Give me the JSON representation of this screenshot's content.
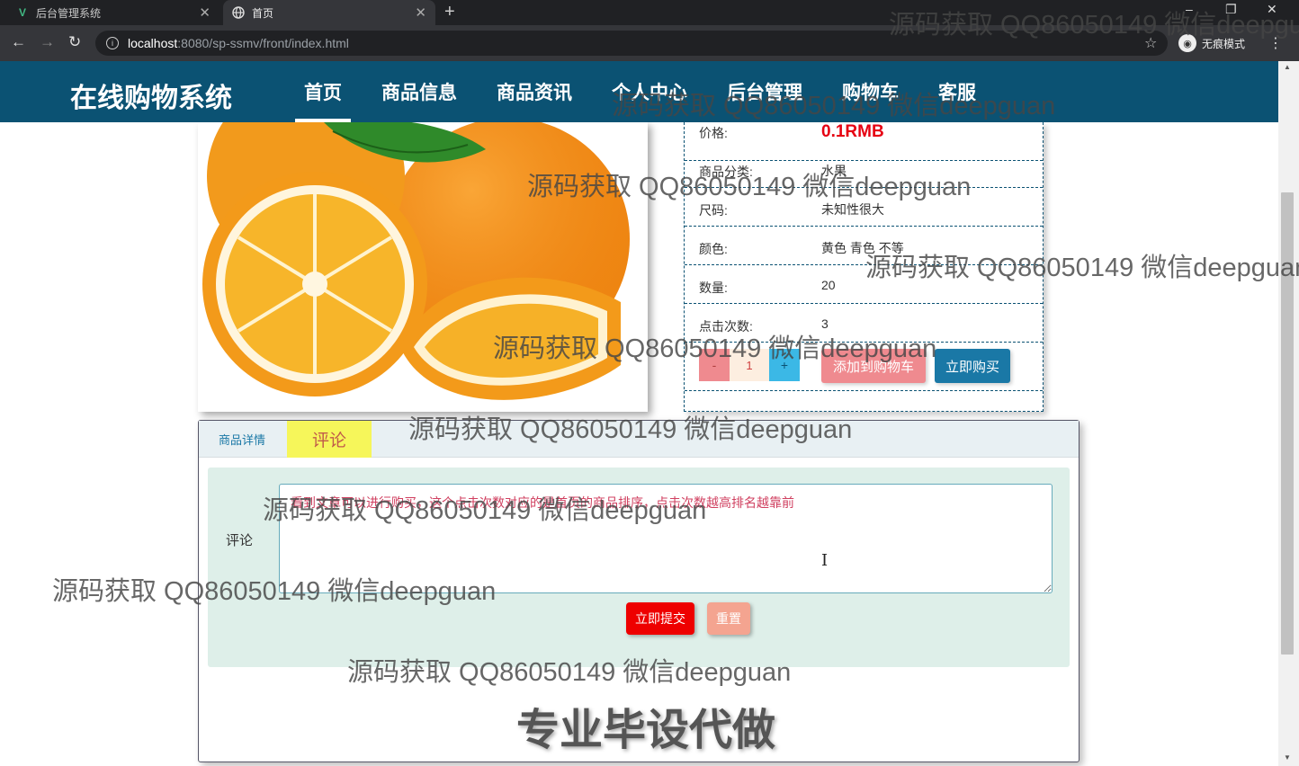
{
  "browser": {
    "tabs": [
      {
        "label": "后台管理系统",
        "icon": "vue-logo-icon",
        "active": false
      },
      {
        "label": "首页",
        "icon": "globe-icon",
        "active": true
      }
    ],
    "url_host": "localhost",
    "url_path": ":8080/sp-ssmv/front/index.html",
    "incognito_label": "无痕模式"
  },
  "site": {
    "brand": "在线购物系统",
    "nav": [
      "首页",
      "商品信息",
      "商品资讯",
      "个人中心",
      "后台管理",
      "购物车",
      "客服"
    ],
    "active_nav": "首页",
    "colors": {
      "nav_bg": "#0b5273",
      "price": "#e60012"
    }
  },
  "product": {
    "image_alt": "orange",
    "specs": [
      {
        "key": "价格:",
        "value": "0.1RMB"
      },
      {
        "key": "商品分类:",
        "value": "水果"
      },
      {
        "key": "尺码:",
        "value": "未知性很大"
      },
      {
        "key": "颜色:",
        "value": "黄色 青色 不等"
      },
      {
        "key": "数量:",
        "value": "20"
      },
      {
        "key": "点击次数:",
        "value": "3"
      }
    ],
    "qty": {
      "minus": "-",
      "value": "1",
      "plus": "+"
    },
    "add_to_cart": "添加到购物车",
    "buy_now": "立即购买"
  },
  "tabs_panel": {
    "tabs": [
      "商品详情",
      "评论"
    ],
    "active_tab": "评论",
    "comment_label": "评论",
    "comment_text": "看到文章可以进行购买，这个点击次数对应的是首页的商品排序，点击次数越高排名越靠前",
    "submit": "立即提交",
    "reset": "重置"
  },
  "watermarks": {
    "text": "源码获取 QQ86050149 微信deepguan",
    "big": "专业毕设代做"
  }
}
